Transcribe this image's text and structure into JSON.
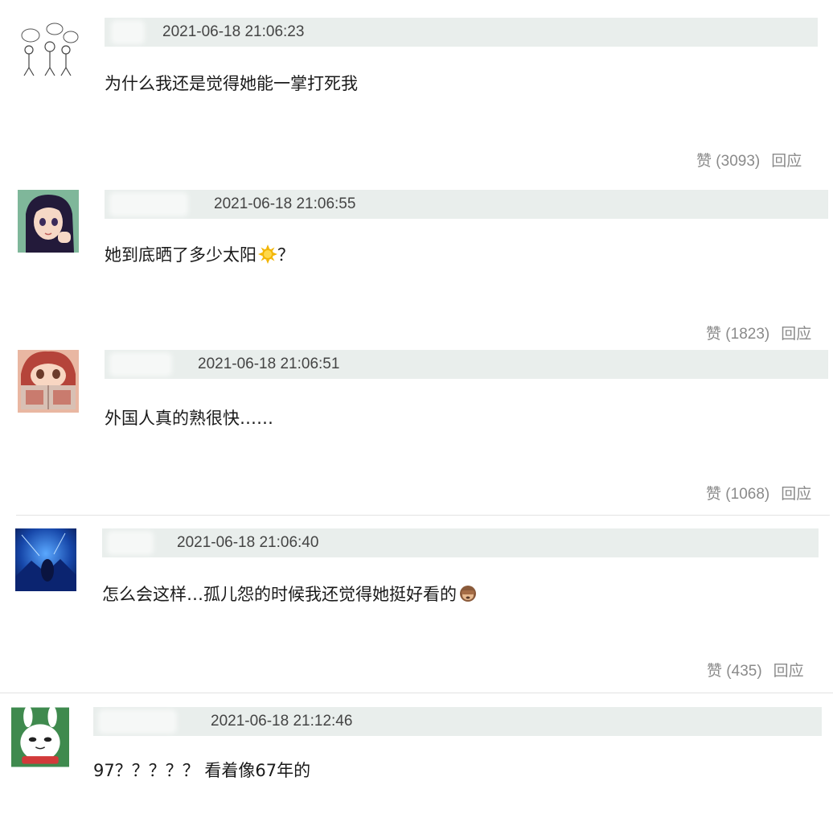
{
  "comments": [
    {
      "timestamp": "2021-06-18 21:06:23",
      "text": "为什么我还是觉得她能一掌打死我",
      "like_label": "赞",
      "like_count": "(3093)",
      "reply_label": "回应",
      "avatar_icon": "sketch-figures-avatar"
    },
    {
      "timestamp": "2021-06-18 21:06:55",
      "text": "她到底晒了多少太阳",
      "text_suffix": "？",
      "emoji_icon": "sun-emoji",
      "like_label": "赞",
      "like_count": "(1823)",
      "reply_label": "回应",
      "avatar_icon": "anime-girl-avatar"
    },
    {
      "timestamp": "2021-06-18 21:06:51",
      "text": "外国人真的熟很快……",
      "like_label": "赞",
      "like_count": "(1068)",
      "reply_label": "回应",
      "avatar_icon": "anime-reading-avatar"
    },
    {
      "timestamp": "2021-06-18 21:06:40",
      "text": "怎么会这样…孤儿怨的时候我还觉得她挺好看的",
      "emoji_icon": "see-no-evil-monkey-emoji",
      "like_label": "赞",
      "like_count": "(435)",
      "reply_label": "回应",
      "avatar_icon": "blue-night-scene-avatar"
    },
    {
      "timestamp": "2021-06-18 21:12:46",
      "text": "97？？？？？ 看着像67年的",
      "avatar_icon": "white-rabbit-cartoon-avatar"
    }
  ],
  "colors": {
    "meta_bar_bg": "#e9eeec",
    "action_text": "#8a8a8a",
    "body_text": "#1a1a1a"
  }
}
